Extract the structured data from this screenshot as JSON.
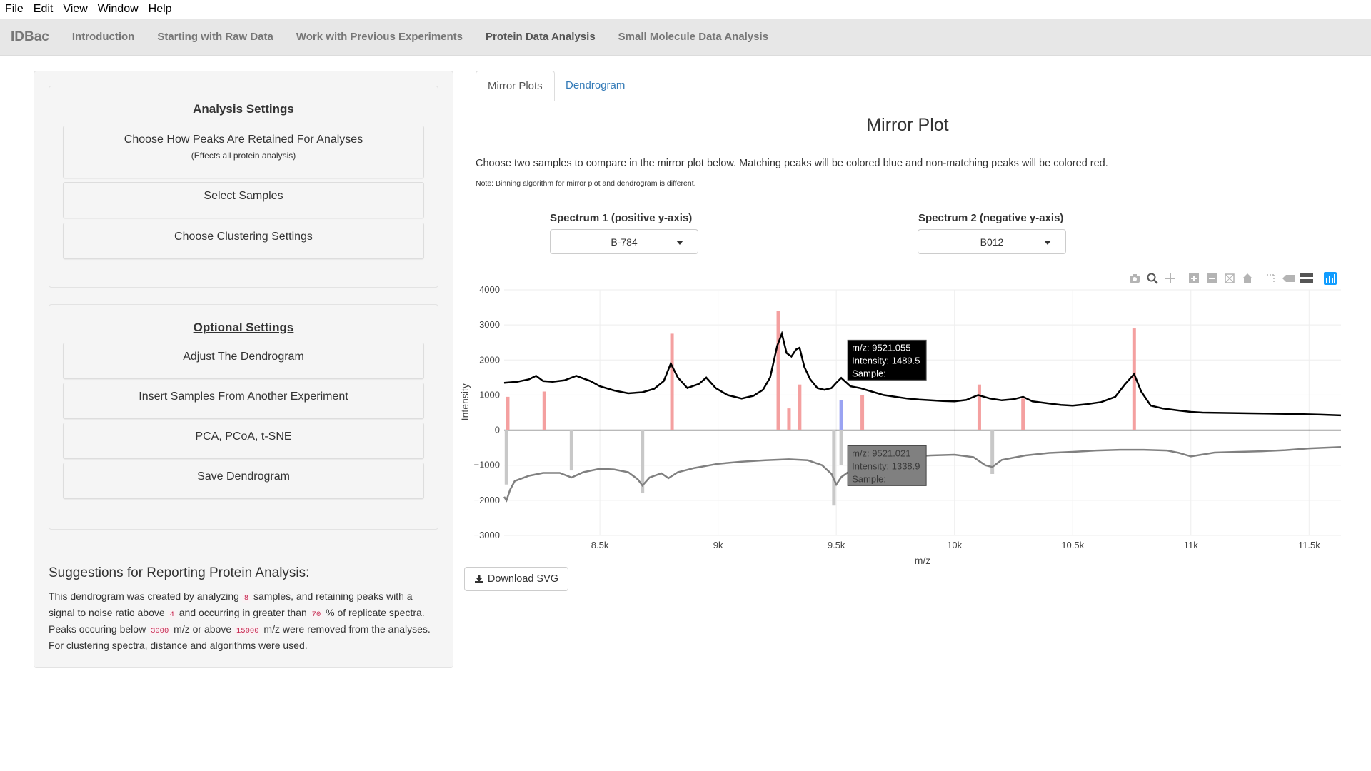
{
  "menu": [
    "File",
    "Edit",
    "View",
    "Window",
    "Help"
  ],
  "navbar": {
    "brand": "IDBac",
    "links": [
      "Introduction",
      "Starting with Raw Data",
      "Work with Previous Experiments",
      "Protein Data Analysis",
      "Small Molecule Data Analysis"
    ]
  },
  "sidebar": {
    "analysis_settings": {
      "title": "Analysis Settings",
      "buttons": [
        {
          "label": "Choose How Peaks Are Retained For Analyses",
          "sub": "(Effects all protein analysis)"
        },
        {
          "label": "Select Samples"
        },
        {
          "label": "Choose Clustering Settings"
        }
      ]
    },
    "optional_settings": {
      "title": "Optional Settings",
      "buttons": [
        {
          "label": "Adjust The Dendrogram"
        },
        {
          "label": "Insert Samples From Another Experiment"
        },
        {
          "label": "PCA, PCoA, t-SNE"
        },
        {
          "label": "Save Dendrogram"
        }
      ]
    },
    "suggestions": {
      "title": "Suggestions for Reporting Protein Analysis:",
      "t1": "This dendrogram was created by analyzing ",
      "samples": "8",
      "t2": " samples, and retaining peaks with a signal to noise ratio above ",
      "snr": "4",
      "t3": " and occurring in greater than ",
      "pct": "70",
      "t4": " % of replicate spectra. Peaks occuring below ",
      "low": "3000",
      "t5": " m/z or above ",
      "high": "15000",
      "t6": " m/z were removed from the analyses. For clustering spectra, ",
      "t7": " distance and ",
      "t8": " algorithms were used."
    }
  },
  "tabs": [
    "Mirror Plots",
    "Dendrogram"
  ],
  "main": {
    "title": "Mirror Plot",
    "description": "Choose two samples to compare in the mirror plot below. Matching peaks will be colored blue and non-matching peaks will be colored red.",
    "note": "Note: Binning algorithm for mirror plot and dendrogram is different.",
    "spectrum1_label": "Spectrum 1 (positive y-axis)",
    "spectrum1_value": "B-784",
    "spectrum2_label": "Spectrum 2 (negative y-axis)",
    "spectrum2_value": "B012",
    "download_label": "Download SVG"
  },
  "modebar_icons": [
    "camera-icon",
    "zoom-icon",
    "pan-icon",
    "zoom-in-icon",
    "zoom-out-icon",
    "autoscale-icon",
    "reset-axes-icon",
    "spike-lines-icon",
    "hover-closest-icon",
    "hover-compare-icon",
    "plotly-logo-icon"
  ],
  "chart_data": {
    "type": "line",
    "xlabel": "m/z",
    "ylabel": "Intensity",
    "xlim": [
      8095,
      11635
    ],
    "ylim": [
      -3000,
      4000
    ],
    "x_ticks": [
      8500,
      9000,
      9500,
      10000,
      10500,
      11000,
      11500
    ],
    "x_tick_labels": [
      "8.5k",
      "9k",
      "9.5k",
      "10k",
      "10.5k",
      "11k",
      "11.5k"
    ],
    "y_ticks": [
      4000,
      3000,
      2000,
      1000,
      0,
      -1000,
      -2000,
      -3000
    ],
    "y_tick_labels": [
      "4000",
      "3000",
      "2000",
      "1000",
      "0",
      "−1000",
      "−2000",
      "−3000"
    ],
    "colors": {
      "positive_line": "#000000",
      "negative_line": "#808080",
      "unmatched_peak": "#f4a0a0",
      "matched_peak": "#9aa3f2",
      "negative_peak": "#c8c8c8"
    },
    "positive_series": {
      "x": [
        8095,
        8150,
        8200,
        8230,
        8260,
        8300,
        8350,
        8400,
        8460,
        8500,
        8560,
        8620,
        8680,
        8730,
        8770,
        8800,
        8830,
        8870,
        8920,
        8950,
        8990,
        9040,
        9100,
        9150,
        9190,
        9220,
        9250,
        9270,
        9290,
        9310,
        9330,
        9345,
        9365,
        9390,
        9420,
        9450,
        9480,
        9500,
        9521,
        9560,
        9600,
        9650,
        9700,
        9750,
        9800,
        9850,
        9900,
        9950,
        10000,
        10050,
        10100,
        10150,
        10200,
        10250,
        10290,
        10330,
        10400,
        10450,
        10500,
        10560,
        10620,
        10680,
        10720,
        10760,
        10790,
        10830,
        10880,
        10950,
        11000,
        11050,
        11150,
        11250,
        11350,
        11450,
        11550,
        11635
      ],
      "y": [
        1350,
        1380,
        1450,
        1550,
        1400,
        1380,
        1420,
        1550,
        1400,
        1250,
        1130,
        1050,
        1080,
        1180,
        1400,
        1900,
        1500,
        1200,
        1320,
        1500,
        1200,
        1000,
        900,
        980,
        1150,
        1500,
        2400,
        2750,
        2200,
        2100,
        2300,
        2350,
        1800,
        1450,
        1200,
        1150,
        1200,
        1350,
        1489,
        1250,
        1200,
        1100,
        1000,
        950,
        900,
        870,
        850,
        830,
        820,
        860,
        1000,
        900,
        850,
        880,
        950,
        820,
        760,
        720,
        700,
        740,
        800,
        950,
        1300,
        1600,
        1100,
        700,
        620,
        560,
        520,
        500,
        490,
        480,
        470,
        460,
        440,
        420
      ]
    },
    "negative_series": {
      "x": [
        8095,
        8105,
        8120,
        8140,
        8200,
        8260,
        8330,
        8380,
        8430,
        8500,
        8560,
        8620,
        8660,
        8680,
        8710,
        8760,
        8790,
        8830,
        8900,
        9000,
        9100,
        9200,
        9300,
        9380,
        9440,
        9480,
        9500,
        9521,
        9560,
        9600,
        9650,
        9700,
        9800,
        9900,
        10000,
        10080,
        10130,
        10160,
        10200,
        10300,
        10400,
        10500,
        10600,
        10700,
        10800,
        10900,
        10950,
        11000,
        11100,
        11200,
        11300,
        11400,
        11500,
        11635
      ],
      "y": [
        -1900,
        -2000,
        -1700,
        -1450,
        -1300,
        -1220,
        -1220,
        -1350,
        -1200,
        -1100,
        -1120,
        -1200,
        -1400,
        -1580,
        -1350,
        -1230,
        -1370,
        -1200,
        -1080,
        -960,
        -900,
        -860,
        -830,
        -860,
        -1000,
        -1250,
        -1550,
        -1339,
        -1150,
        -950,
        -870,
        -820,
        -760,
        -720,
        -700,
        -770,
        -1000,
        -1050,
        -850,
        -720,
        -650,
        -620,
        -580,
        -560,
        -560,
        -580,
        -650,
        -750,
        -640,
        -620,
        -600,
        -570,
        -520,
        -480
      ]
    },
    "positive_peaks": [
      {
        "x": 8110,
        "y": 950,
        "matched": false
      },
      {
        "x": 8265,
        "y": 1100,
        "matched": false
      },
      {
        "x": 8805,
        "y": 2750,
        "matched": false
      },
      {
        "x": 9255,
        "y": 3400,
        "matched": false
      },
      {
        "x": 9300,
        "y": 620,
        "matched": false
      },
      {
        "x": 9345,
        "y": 1300,
        "matched": false
      },
      {
        "x": 9521,
        "y": 860,
        "matched": true
      },
      {
        "x": 9610,
        "y": 1000,
        "matched": false
      },
      {
        "x": 10105,
        "y": 1300,
        "matched": false
      },
      {
        "x": 10290,
        "y": 900,
        "matched": false
      },
      {
        "x": 10760,
        "y": 2900,
        "matched": false
      }
    ],
    "negative_peaks": [
      {
        "x": 8105,
        "y": -1550
      },
      {
        "x": 8380,
        "y": -1150
      },
      {
        "x": 8680,
        "y": -1800
      },
      {
        "x": 9490,
        "y": -2150
      },
      {
        "x": 9521,
        "y": -1000
      },
      {
        "x": 10160,
        "y": -1250
      }
    ],
    "hover_positive": {
      "mz_label": "m/z: 9521.055",
      "intensity_label": "Intensity: 1489.5",
      "sample_label": "Sample:"
    },
    "hover_negative": {
      "mz_label": "m/z: 9521.021",
      "intensity_label": "Intensity: 1338.9",
      "sample_label": "Sample:"
    }
  }
}
